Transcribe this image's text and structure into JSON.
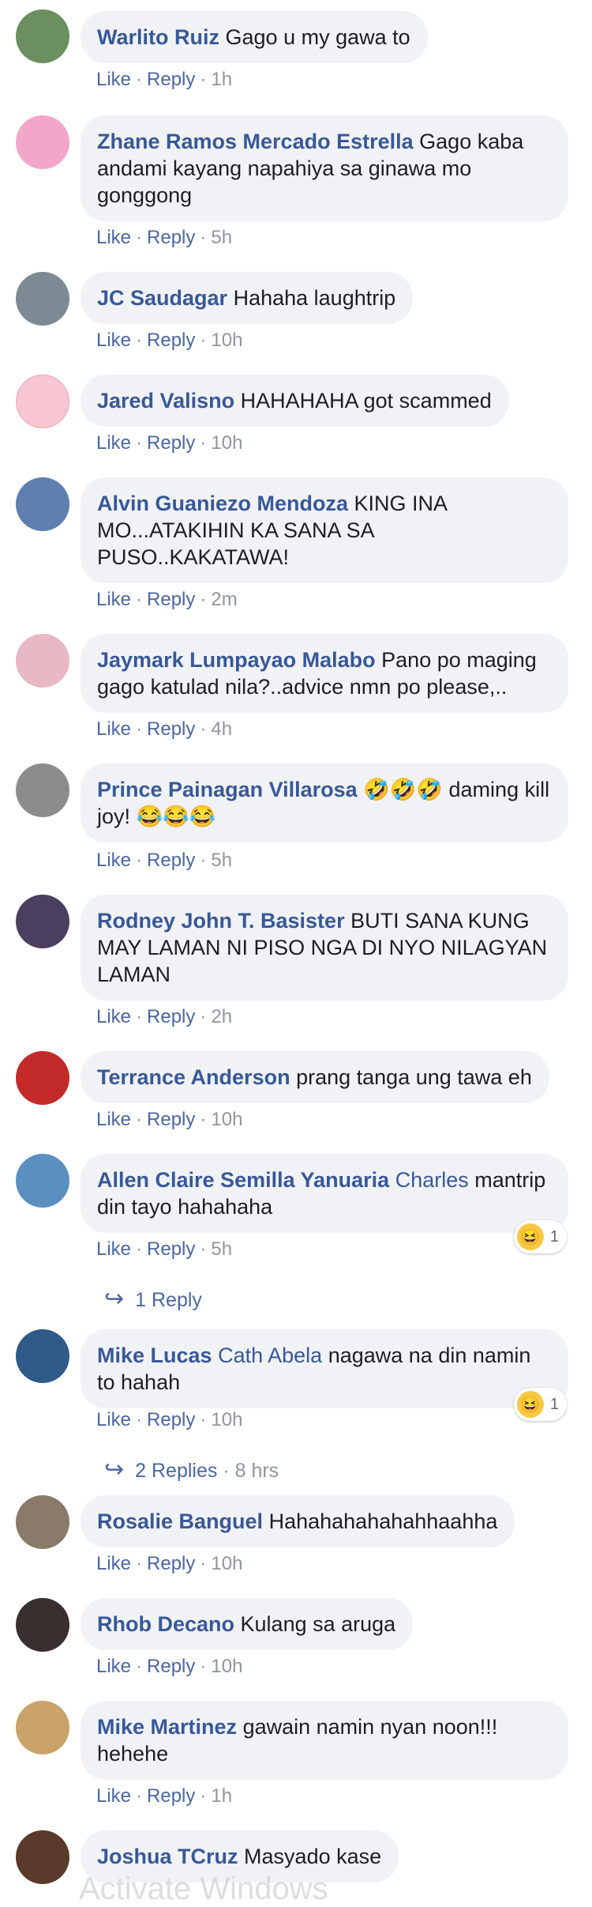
{
  "labels": {
    "like": "Like",
    "reply": "Reply",
    "sep": "·"
  },
  "comments": [
    {
      "author": "Warlito Ruiz",
      "mention": "",
      "text": "Gago u my gawa to",
      "time": "1h",
      "avatar_color": "#6b8f5e"
    },
    {
      "author": "Zhane Ramos Mercado Estrella",
      "mention": "",
      "text": "Gago kaba andami kayang napahiya sa ginawa mo gonggong",
      "time": "5h",
      "avatar_color": "#f2a6c8"
    },
    {
      "author": "JC Saudagar",
      "mention": "",
      "text": "Hahaha laughtrip",
      "time": "10h",
      "avatar_color": "#7d8a94"
    },
    {
      "author": "Jared Valisno",
      "mention": "",
      "text": "HAHAHAHA got scammed",
      "time": "10h",
      "avatar_color": "#f7c6d0"
    },
    {
      "author": "Alvin Guaniezo Mendoza",
      "mention": "",
      "text": "KING INA MO...ATAKIHIN KA SANA SA PUSO..KAKATAWA!",
      "time": "2m",
      "avatar_color": "#5e7fb0"
    },
    {
      "author": "Jaymark Lumpayao Malabo",
      "mention": "",
      "text": "Pano po maging gago katulad nila?..advice nmn po please,..",
      "time": "4h",
      "avatar_color": "#e8b8c4"
    },
    {
      "author": "Prince Painagan Villarosa",
      "mention": "",
      "text": "🤣🤣🤣 daming kill joy! 😂😂😂",
      "time": "5h",
      "avatar_color": "#8c8c8c"
    },
    {
      "author": "Rodney John T. Basister",
      "mention": "",
      "text": "BUTI SANA KUNG MAY LAMAN NI PISO NGA DI NYO NILAGYAN LAMAN",
      "time": "2h",
      "avatar_color": "#4a3f5e"
    },
    {
      "author": "Terrance Anderson",
      "mention": "",
      "text": "prang tanga ung tawa eh",
      "time": "10h",
      "avatar_color": "#c22a2a"
    },
    {
      "author": "Allen Claire Semilla Yanuaria",
      "mention": "Charles",
      "text": "mantrip din tayo hahahaha",
      "time": "5h",
      "avatar_color": "#5a8fbf",
      "reaction_count": "1",
      "replies_label": "1 Reply",
      "replies_ago": ""
    },
    {
      "author": "Mike Lucas",
      "mention": "Cath Abela",
      "text": "nagawa na din namin to hahah",
      "time": "10h",
      "avatar_color": "#2f5a8a",
      "reaction_count": "1",
      "replies_label": "2 Replies",
      "replies_ago": "· 8 hrs"
    },
    {
      "author": "Rosalie Banguel",
      "mention": "",
      "text": "Hahahahahahahhaahha",
      "time": "10h",
      "avatar_color": "#8a7a6a"
    },
    {
      "author": "Rhob Decano",
      "mention": "",
      "text": "Kulang sa aruga",
      "time": "10h",
      "avatar_color": "#3a2f2f"
    },
    {
      "author": "Mike Martinez",
      "mention": "",
      "text": "gawain namin nyan noon!!! hehehe",
      "time": "1h",
      "avatar_color": "#c9a36a"
    },
    {
      "author": "Joshua TCruz",
      "mention": "",
      "text": "Masyado kase",
      "time": "",
      "avatar_color": "#5a3a2a"
    }
  ],
  "watermark": "Activate Windows"
}
